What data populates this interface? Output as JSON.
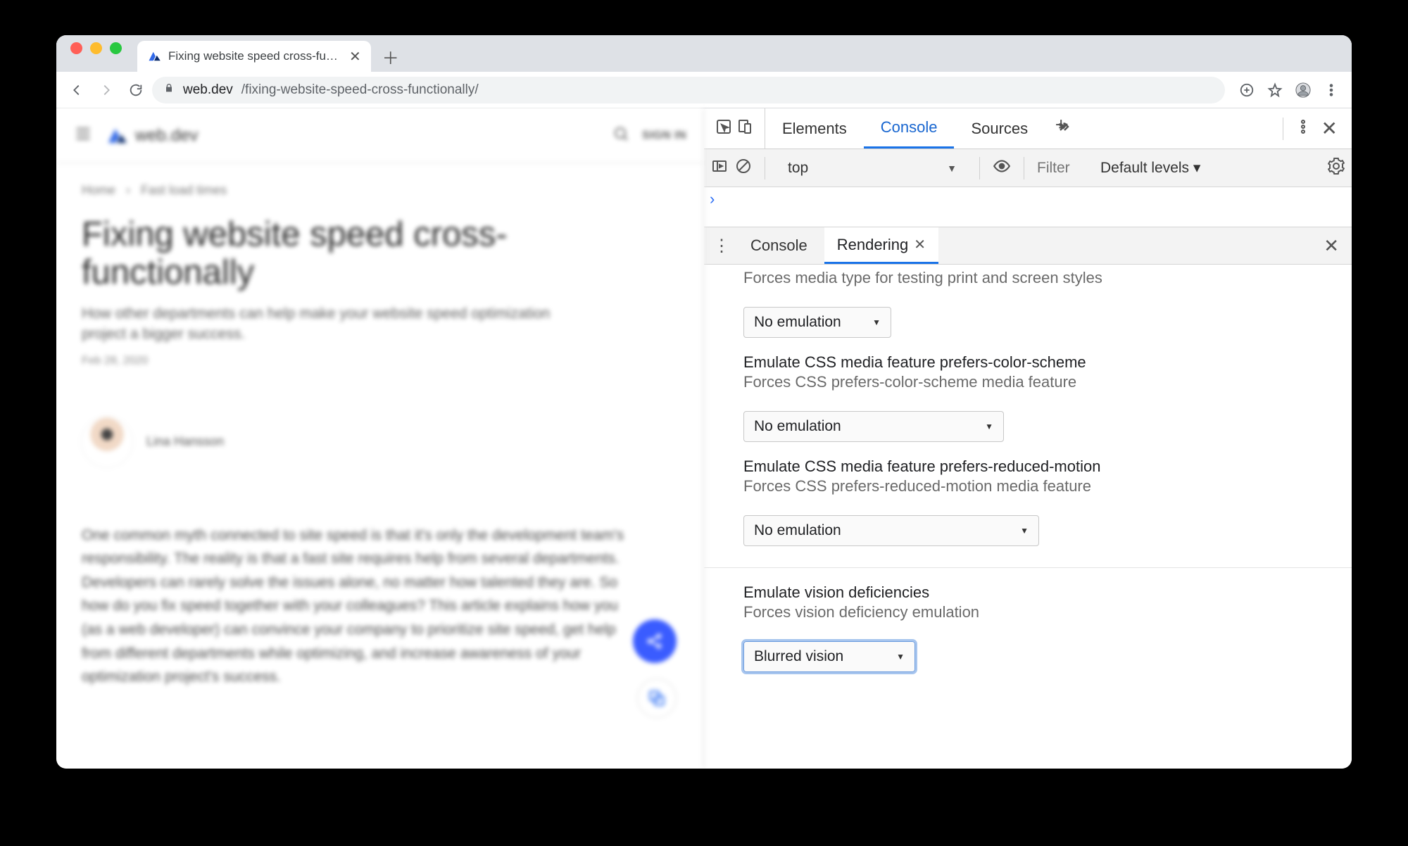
{
  "browser": {
    "tab_title": "Fixing website speed cross-fu…",
    "new_tab_tooltip": "+",
    "nav": {
      "back": "←",
      "forward": "→",
      "reload": "↻"
    },
    "url_host": "web.dev",
    "url_path": "/fixing-website-speed-cross-functionally/",
    "right_icons": [
      "add-to",
      "star",
      "profile",
      "menu"
    ]
  },
  "page": {
    "site_name": "web.dev",
    "sign_in": "SIGN IN",
    "breadcrumbs": {
      "home": "Home",
      "section": "Fast load times"
    },
    "title": "Fixing website speed cross-functionally",
    "subtitle": "How other departments can help make your website speed optimization project a bigger success.",
    "date": "Feb 28, 2020",
    "author": "Lina Hansson",
    "body": "One common myth connected to site speed is that it's only the development team's responsibility. The reality is that a fast site requires help from several departments. Developers can rarely solve the issues alone, no matter how talented they are. So how do you fix speed together with your colleagues? This article explains how you (as a web developer) can convince your company to prioritize site speed, get help from different departments while optimizing, and increase awareness of your optimization project's success."
  },
  "devtools": {
    "tabs": {
      "elements": "Elements",
      "console": "Console",
      "sources": "Sources"
    },
    "sub": {
      "context": "top",
      "filter_placeholder": "Filter",
      "levels": "Default levels ▾"
    },
    "drawer": {
      "console": "Console",
      "rendering": "Rendering"
    },
    "rendering": {
      "media_type_desc": "Forces media type for testing print and screen styles",
      "media_type_value": "No emulation",
      "color_scheme_title": "Emulate CSS media feature prefers-color-scheme",
      "color_scheme_desc": "Forces CSS prefers-color-scheme media feature",
      "color_scheme_value": "No emulation",
      "reduced_motion_title": "Emulate CSS media feature prefers-reduced-motion",
      "reduced_motion_desc": "Forces CSS prefers-reduced-motion media feature",
      "reduced_motion_value": "No emulation",
      "vision_title": "Emulate vision deficiencies",
      "vision_desc": "Forces vision deficiency emulation",
      "vision_value": "Blurred vision"
    }
  }
}
